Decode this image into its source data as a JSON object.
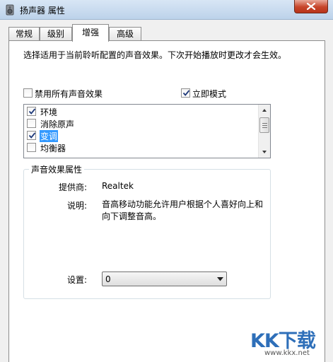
{
  "window": {
    "title": "扬声器 属性",
    "icon": "speaker-icon",
    "close_icon": "close-icon"
  },
  "tabs": [
    {
      "label": "常规",
      "active": false
    },
    {
      "label": "级别",
      "active": false
    },
    {
      "label": "增强",
      "active": true
    },
    {
      "label": "高级",
      "active": false
    }
  ],
  "enhancements": {
    "description": "选择适用于当前聆听配置的声音效果。下次开始播放时更改才会生效。",
    "disable_all": {
      "label": "禁用所有声音效果",
      "checked": false
    },
    "immediate_mode": {
      "label": "立即模式",
      "checked": true
    },
    "effects": [
      {
        "label": "环境",
        "checked": true,
        "selected": false
      },
      {
        "label": "消除原声",
        "checked": false,
        "selected": false
      },
      {
        "label": "变调",
        "checked": true,
        "selected": true
      },
      {
        "label": "均衡器",
        "checked": false,
        "selected": false
      }
    ]
  },
  "properties": {
    "group_title": "声音效果属性",
    "provider_label": "提供商:",
    "provider_value": "Realtek",
    "description_label": "说明:",
    "description_value": "音高移动功能允许用户根据个人喜好向上和向下调整音高。",
    "setting_label": "设置:",
    "setting_value": "0"
  },
  "watermark": {
    "logo": "KK下载",
    "url": "www.kkx.net"
  },
  "colors": {
    "selection": "#3399ff",
    "close_button": "#c7452a",
    "watermark": "#2e6fb9"
  }
}
